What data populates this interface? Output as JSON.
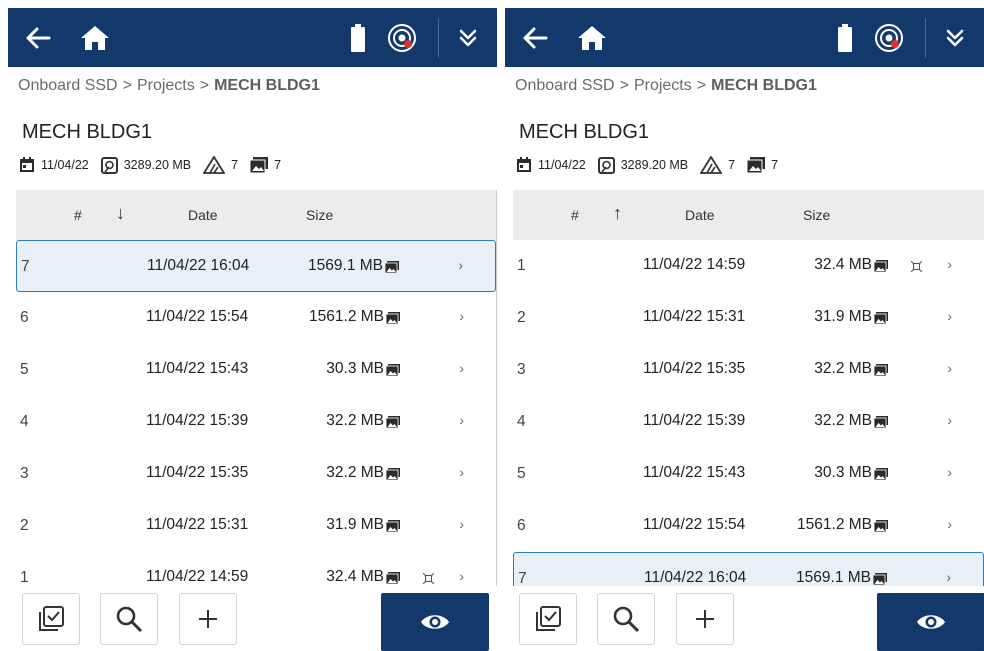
{
  "colors": {
    "topbar": "#13386b",
    "selected_row": "#e6f0f6",
    "selected_border": "#2b7bbd",
    "header_bg": "#ececec"
  },
  "icons": {
    "back": "arrow-left-icon",
    "home": "home-icon",
    "battery": "battery-icon",
    "gps": "gps-satellite-icon",
    "more": "chevron-double-down-icon",
    "date": "calendar-icon",
    "size": "storage-icon",
    "scans": "scan-icon",
    "images": "image-icon",
    "select": "checklist-icon",
    "search": "search-icon",
    "add": "plus-icon",
    "view": "eye-icon"
  },
  "panels": [
    {
      "breadcrumb": {
        "root": "Onboard SSD",
        "sep1": ">",
        "mid": "Projects",
        "sep2": ">",
        "current": "MECH BLDG1"
      },
      "title": "MECH BLDG1",
      "meta": {
        "date": "11/04/22",
        "size": "3289.20 MB",
        "scans": "7",
        "images": "7"
      },
      "header": {
        "num": "#",
        "sort": "↓",
        "date": "Date",
        "size": "Size"
      },
      "sort_direction": "descending",
      "rows": [
        {
          "num": "7",
          "date": "11/04/22 16:04",
          "size": "1569.1 MB",
          "chev": "›",
          "selected": true,
          "flag": false
        },
        {
          "num": "6",
          "date": "11/04/22 15:54",
          "size": "1561.2 MB",
          "chev": "›",
          "selected": false,
          "flag": false
        },
        {
          "num": "5",
          "date": "11/04/22 15:43",
          "size": "30.3 MB",
          "chev": "›",
          "selected": false,
          "flag": false
        },
        {
          "num": "4",
          "date": "11/04/22 15:39",
          "size": "32.2 MB",
          "chev": "›",
          "selected": false,
          "flag": false
        },
        {
          "num": "3",
          "date": "11/04/22 15:35",
          "size": "32.2 MB",
          "chev": "›",
          "selected": false,
          "flag": false
        },
        {
          "num": "2",
          "date": "11/04/22 15:31",
          "size": "31.9 MB",
          "chev": "›",
          "selected": false,
          "flag": false
        },
        {
          "num": "1",
          "date": "11/04/22 14:59",
          "size": "32.4 MB",
          "chev": "›",
          "selected": false,
          "flag": true
        }
      ]
    },
    {
      "breadcrumb": {
        "root": "Onboard SSD",
        "sep1": ">",
        "mid": "Projects",
        "sep2": ">",
        "current": "MECH BLDG1"
      },
      "title": "MECH BLDG1",
      "meta": {
        "date": "11/04/22",
        "size": "3289.20 MB",
        "scans": "7",
        "images": "7"
      },
      "header": {
        "num": "#",
        "sort": "↑",
        "date": "Date",
        "size": "Size"
      },
      "sort_direction": "ascending",
      "rows": [
        {
          "num": "1",
          "date": "11/04/22 14:59",
          "size": "32.4 MB",
          "chev": "›",
          "selected": false,
          "flag": true
        },
        {
          "num": "2",
          "date": "11/04/22 15:31",
          "size": "31.9 MB",
          "chev": "›",
          "selected": false,
          "flag": false
        },
        {
          "num": "3",
          "date": "11/04/22 15:35",
          "size": "32.2 MB",
          "chev": "›",
          "selected": false,
          "flag": false
        },
        {
          "num": "4",
          "date": "11/04/22 15:39",
          "size": "32.2 MB",
          "chev": "›",
          "selected": false,
          "flag": false
        },
        {
          "num": "5",
          "date": "11/04/22 15:43",
          "size": "30.3 MB",
          "chev": "›",
          "selected": false,
          "flag": false
        },
        {
          "num": "6",
          "date": "11/04/22 15:54",
          "size": "1561.2 MB",
          "chev": "›",
          "selected": false,
          "flag": false
        },
        {
          "num": "7",
          "date": "11/04/22 16:04",
          "size": "1569.1 MB",
          "chev": "›",
          "selected": true,
          "flag": false
        }
      ]
    }
  ]
}
